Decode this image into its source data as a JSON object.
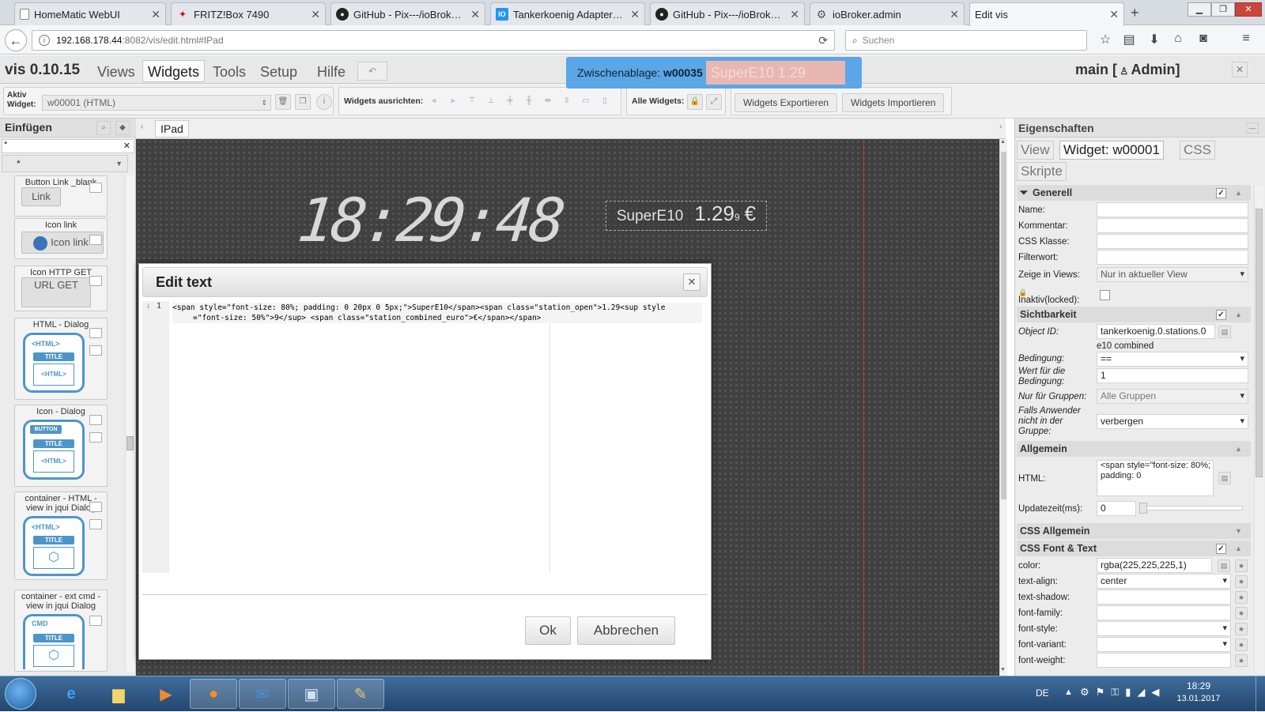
{
  "browser": {
    "tabs": [
      {
        "title": "HomeMatic WebUI",
        "icon": "document-icon"
      },
      {
        "title": "FRITZ!Box 7490",
        "icon": "fritzbox-icon"
      },
      {
        "title": "GitHub - Pix---/ioBroker....",
        "icon": "github-icon"
      },
      {
        "title": "Tankerkoenig Adapter - i...",
        "icon": "iobroker-icon"
      },
      {
        "title": "GitHub - Pix---/ioBroker....",
        "icon": "github-icon"
      },
      {
        "title": "ioBroker.admin",
        "icon": "gear-icon"
      },
      {
        "title": "Edit vis",
        "icon": ""
      }
    ],
    "url_host": "192.168.178.44",
    "url_rest": ":8082/vis/edit.html#IPad",
    "search_placeholder": "Suchen"
  },
  "vis": {
    "version": "vis 0.10.15",
    "menu": [
      "Views",
      "Widgets",
      "Tools",
      "Setup",
      "Hilfe"
    ],
    "active_menu": "Widgets",
    "clipboard_label": "Zwischenablage:",
    "clipboard_id": "w00035",
    "clipboard_preview": "SuperE10  1.29",
    "user": "main [",
    "user_role": "Admin]"
  },
  "toolbar": {
    "active_widget_label": "Aktiv Widget:",
    "active_widget_value": "w00001 (HTML)",
    "align_label": "Widgets ausrichten:",
    "all_widgets_label": "Alle Widgets:",
    "export_label": "Widgets Exportieren",
    "import_label": "Widgets Importieren"
  },
  "insert_panel": {
    "title": "Einfügen",
    "filter_value": "*",
    "widgets": [
      {
        "title": "Button Link _blank",
        "button": "Link"
      },
      {
        "title": "Icon link",
        "button": "Icon link"
      },
      {
        "title": "Icon HTTP GET",
        "button": "URL GET"
      },
      {
        "title": "HTML - Dialog",
        "badge": "<HTML>",
        "inner_title": "TITLE",
        "inner_body": "<HTML>"
      },
      {
        "title": "Icon - Dialog",
        "badge": "BUTTON",
        "inner_title": "TITLE",
        "inner_body": "<HTML>"
      },
      {
        "title": "container - HTML - view in jqui Dialog",
        "badge": "<HTML>",
        "inner_title": "TITLE",
        "inner_body": ""
      },
      {
        "title": "container - ext cmd - view in jqui Dialog",
        "badge": "CMD",
        "inner_title": "TITLE",
        "inner_body": ""
      }
    ]
  },
  "canvas": {
    "view_tab": "IPad",
    "clock": "18:29:48",
    "fuel_name": "SuperE10",
    "fuel_price": "1.29",
    "fuel_sup": "9",
    "fuel_currency": "€"
  },
  "dialog": {
    "title": "Edit text",
    "line_number": "1",
    "code_line1": "<span style=\"font-size: 80%; padding: 0 20px 0 5px;\">SuperE10</span><span class=\"station_open\">1.29<sup style",
    "code_line2": "=\"font-size: 50%\">9</sup> <span class=\"station_combined_euro\">€</span></span>",
    "ok_label": "Ok",
    "cancel_label": "Abbrechen"
  },
  "properties": {
    "title": "Eigenschaften",
    "tabs": [
      "View",
      "Widget: w00001",
      "CSS",
      "Skripte"
    ],
    "sections": {
      "generell": "Generell",
      "sichtbarkeit": "Sichtbarkeit",
      "allgemein": "Allgemein",
      "css_allgemein": "CSS Allgemein",
      "css_font": "CSS Font & Text"
    },
    "fields": {
      "name": "Name:",
      "kommentar": "Kommentar:",
      "css_klasse": "CSS Klasse:",
      "filterwort": "Filterwort:",
      "zeige_views": "Zeige in Views:",
      "zeige_views_value": "Nur in aktueller View",
      "inaktiv": "Inaktiv(locked):",
      "object_id": "Object ID:",
      "object_id_value": "tankerkoenig.0.stations.0",
      "object_id_extra": "e10 combined",
      "bedingung": "Bedingung:",
      "bedingung_value": "==",
      "wert": "Wert für die Bedingung:",
      "wert_value": "1",
      "gruppen": "Nur für Gruppen:",
      "gruppen_value": "Alle Gruppen",
      "falls": "Falls Anwender nicht in der Gruppe:",
      "falls_value": "verbergen",
      "html": "HTML:",
      "html_value": "<span style=\"font-size: 80%; padding: 0",
      "update": "Updatezeit(ms):",
      "update_value": "0",
      "color": "color:",
      "color_value": "rgba(225,225,225,1)",
      "text_align": "text-align:",
      "text_align_value": "center",
      "text_shadow": "text-shadow:",
      "font_family": "font-family:",
      "font_style": "font-style:",
      "font_variant": "font-variant:",
      "font_weight": "font-weight:"
    }
  },
  "taskbar": {
    "lang": "DE",
    "time": "18:29",
    "date": "13.01.2017"
  }
}
